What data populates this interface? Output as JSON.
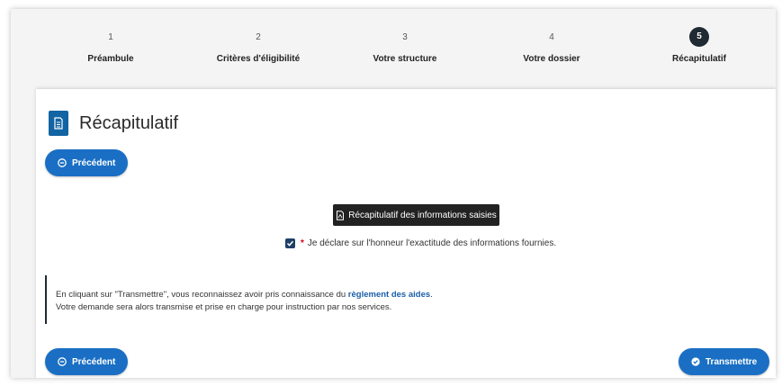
{
  "stepper": {
    "steps": [
      {
        "number": "1",
        "label": "Préambule"
      },
      {
        "number": "2",
        "label": "Critères d'éligibilité"
      },
      {
        "number": "3",
        "label": "Votre structure"
      },
      {
        "number": "4",
        "label": "Votre dossier"
      },
      {
        "number": "5",
        "label": "Récapitulatif"
      }
    ],
    "active_step": 5
  },
  "page": {
    "title": "Récapitulatif",
    "title_icon": "document-icon"
  },
  "nav": {
    "previous_label": "Précédent",
    "submit_label": "Transmettre"
  },
  "summary_button_label": "Récapitulatif des informations saisies",
  "declaration": {
    "required_marker": "*",
    "text": "Je déclare sur l'honneur l'exactitude des informations fournies.",
    "checked": true
  },
  "notice": {
    "line1_prefix": "En cliquant sur \"Transmettre\", vous reconnaissez avoir pris connaissance du",
    "link_text": "règlement des aides",
    "line1_suffix": ".",
    "line2": "Votre demande sera alors transmise et prise en charge pour instruction par nos services."
  },
  "colors": {
    "primary": "#1a6fc4",
    "dark": "#1f2a33",
    "required": "#d0021b"
  }
}
